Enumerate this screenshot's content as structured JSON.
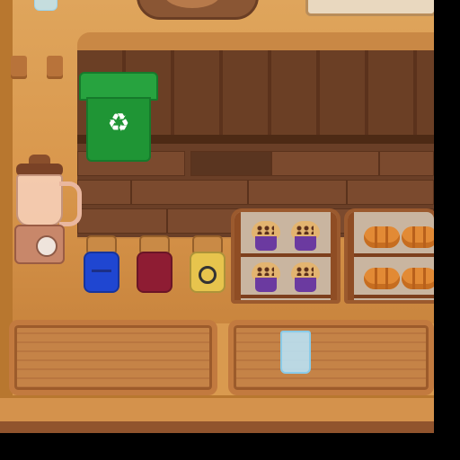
{
  "scene": {
    "title": "",
    "palette": {
      "counter": "#d9974c",
      "shelf_dark": "#6b3f25",
      "recycle_bin": "#1f9535",
      "jar_blue": "#1f46d1",
      "jar_red": "#8e1c33",
      "jar_yellow": "#e7c44d",
      "muffin_cup": "#6b3aa0",
      "croissant": "#e28a35",
      "glass": "#b9e8ff"
    },
    "icons": {
      "recycle": "♻"
    }
  }
}
